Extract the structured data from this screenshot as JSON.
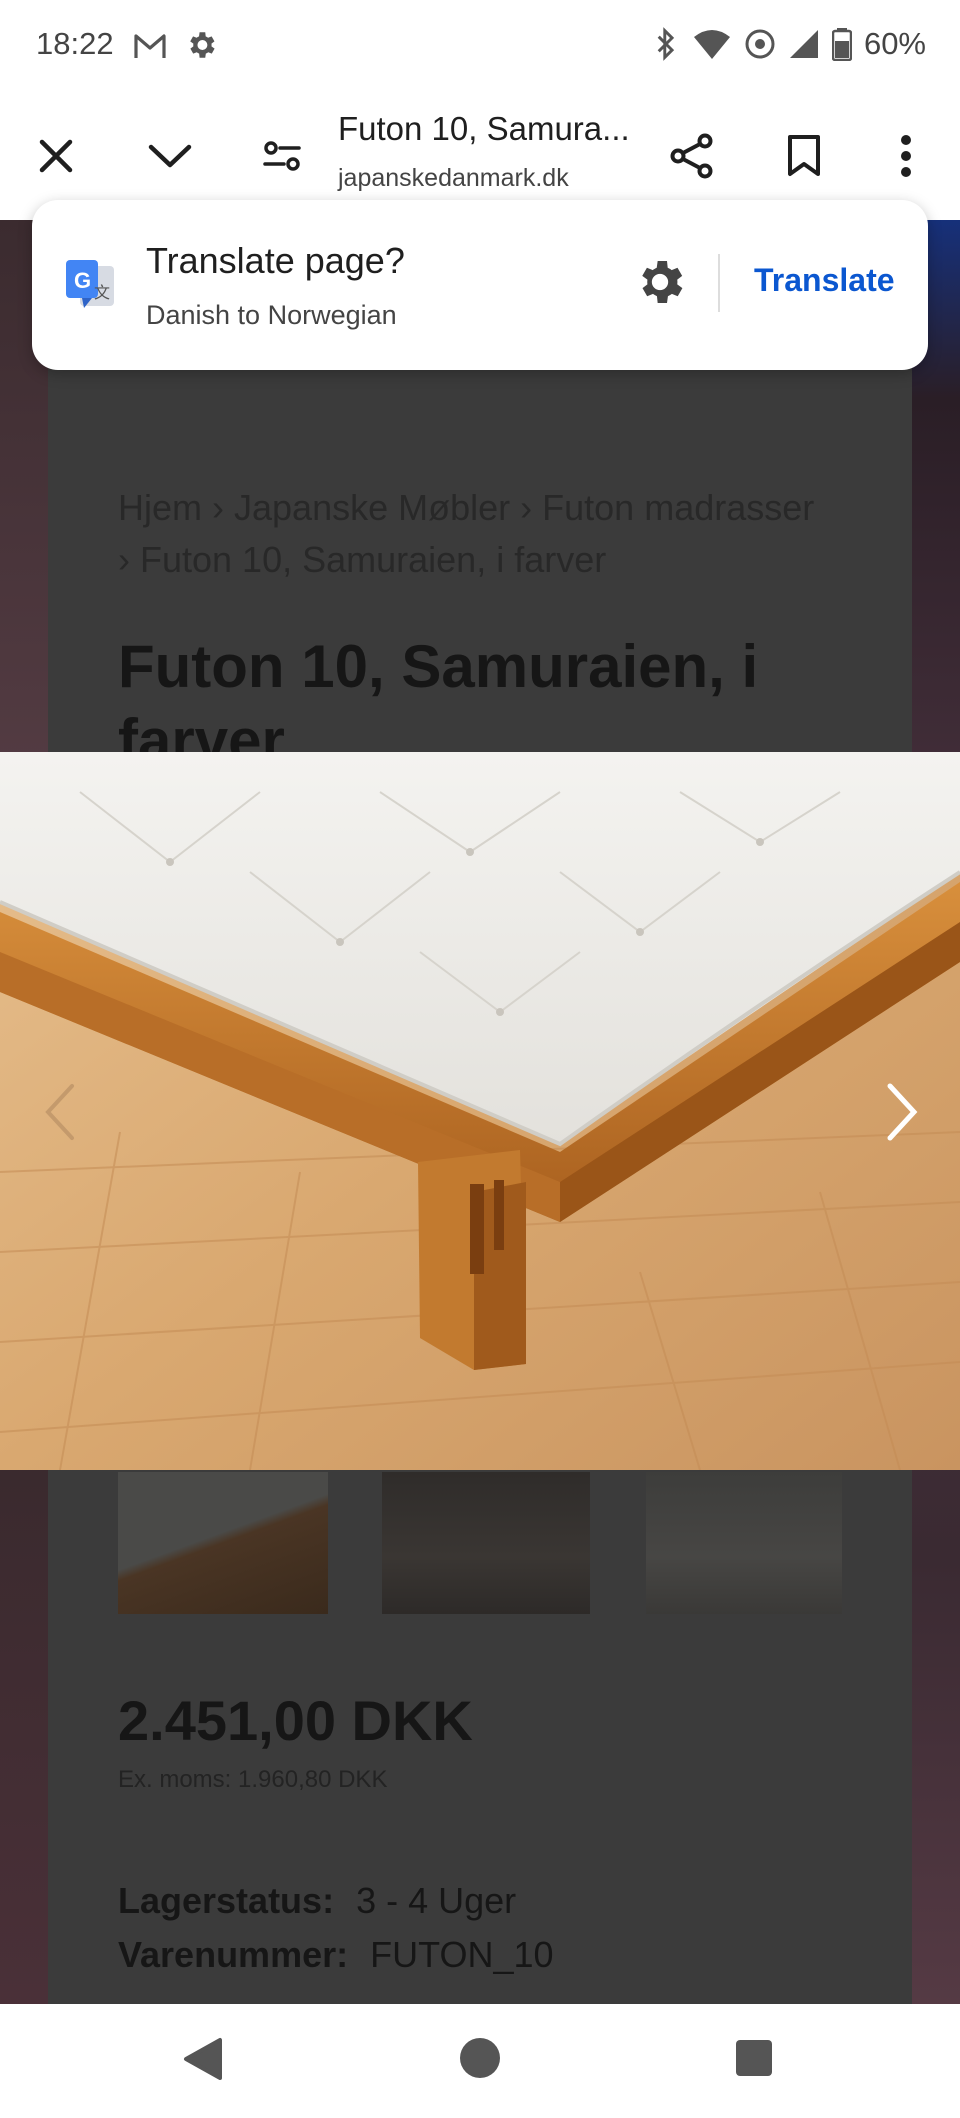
{
  "status": {
    "time": "18:22",
    "battery": "60%"
  },
  "toolbar": {
    "title": "Futon 10, Samura...",
    "url": "japanskedanmark.dk"
  },
  "translate_prompt": {
    "question": "Translate page?",
    "languages": "Danish to Norwegian",
    "button": "Translate"
  },
  "breadcrumb": {
    "home": "Hjem",
    "cat1": "Japanske Møbler",
    "cat2": "Futon madrasser",
    "current": "Futon 10, Samuraien, i farver"
  },
  "product": {
    "title": "Futon 10, Samuraien, i farver",
    "price": "2.451,00 DKK",
    "ex_moms": "Ex. moms: 1.960,80 DKK",
    "stock_label": "Lagerstatus:",
    "stock_value": "3 - 4 Uger",
    "sku_label": "Varenummer:",
    "sku_value": "FUTON_10"
  }
}
